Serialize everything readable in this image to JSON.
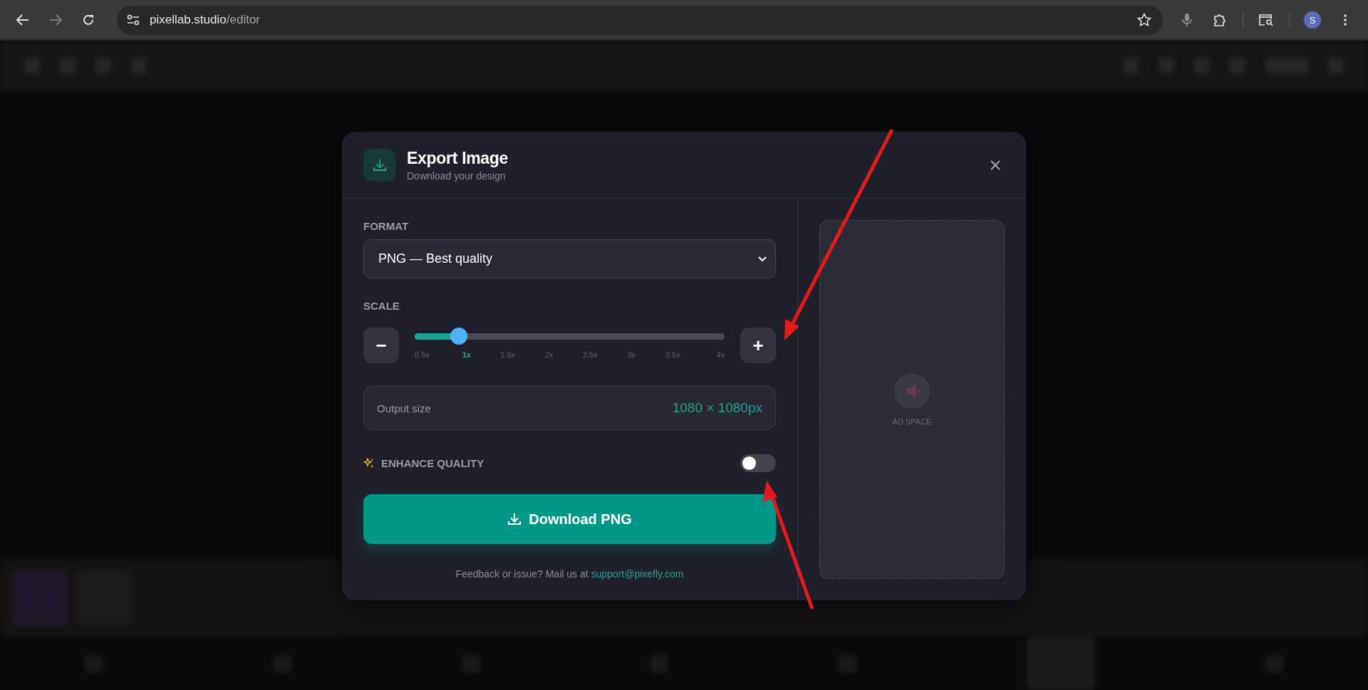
{
  "browser": {
    "url_host": "pixellab.studio",
    "url_path": "/editor",
    "forward_disabled": true,
    "profile_initial": "S"
  },
  "dialog": {
    "title": "Export Image",
    "subtitle": "Download your design",
    "format": {
      "label": "FORMAT",
      "value": "PNG — Best quality"
    },
    "scale": {
      "label": "SCALE",
      "minus": "−",
      "plus": "+",
      "level": 0.143,
      "ticks": [
        {
          "label": "0.5x",
          "selected": false
        },
        {
          "label": "1x",
          "selected": true
        },
        {
          "label": "1.5x",
          "selected": false
        },
        {
          "label": "2x",
          "selected": false
        },
        {
          "label": "2.5x",
          "selected": false
        },
        {
          "label": "3x",
          "selected": false
        },
        {
          "label": "3.5x",
          "selected": false
        },
        {
          "label": "4x",
          "selected": false
        }
      ]
    },
    "output": {
      "label": "Output size",
      "value": "1080 × 1080px"
    },
    "enhance": {
      "label": "ENHANCE QUALITY",
      "on": false
    },
    "download_button": "Download PNG",
    "feedback": {
      "text": "Feedback or issue? Mail us at",
      "link": "support@pixefly.com"
    },
    "ad": {
      "label": "AD SPACE"
    }
  }
}
